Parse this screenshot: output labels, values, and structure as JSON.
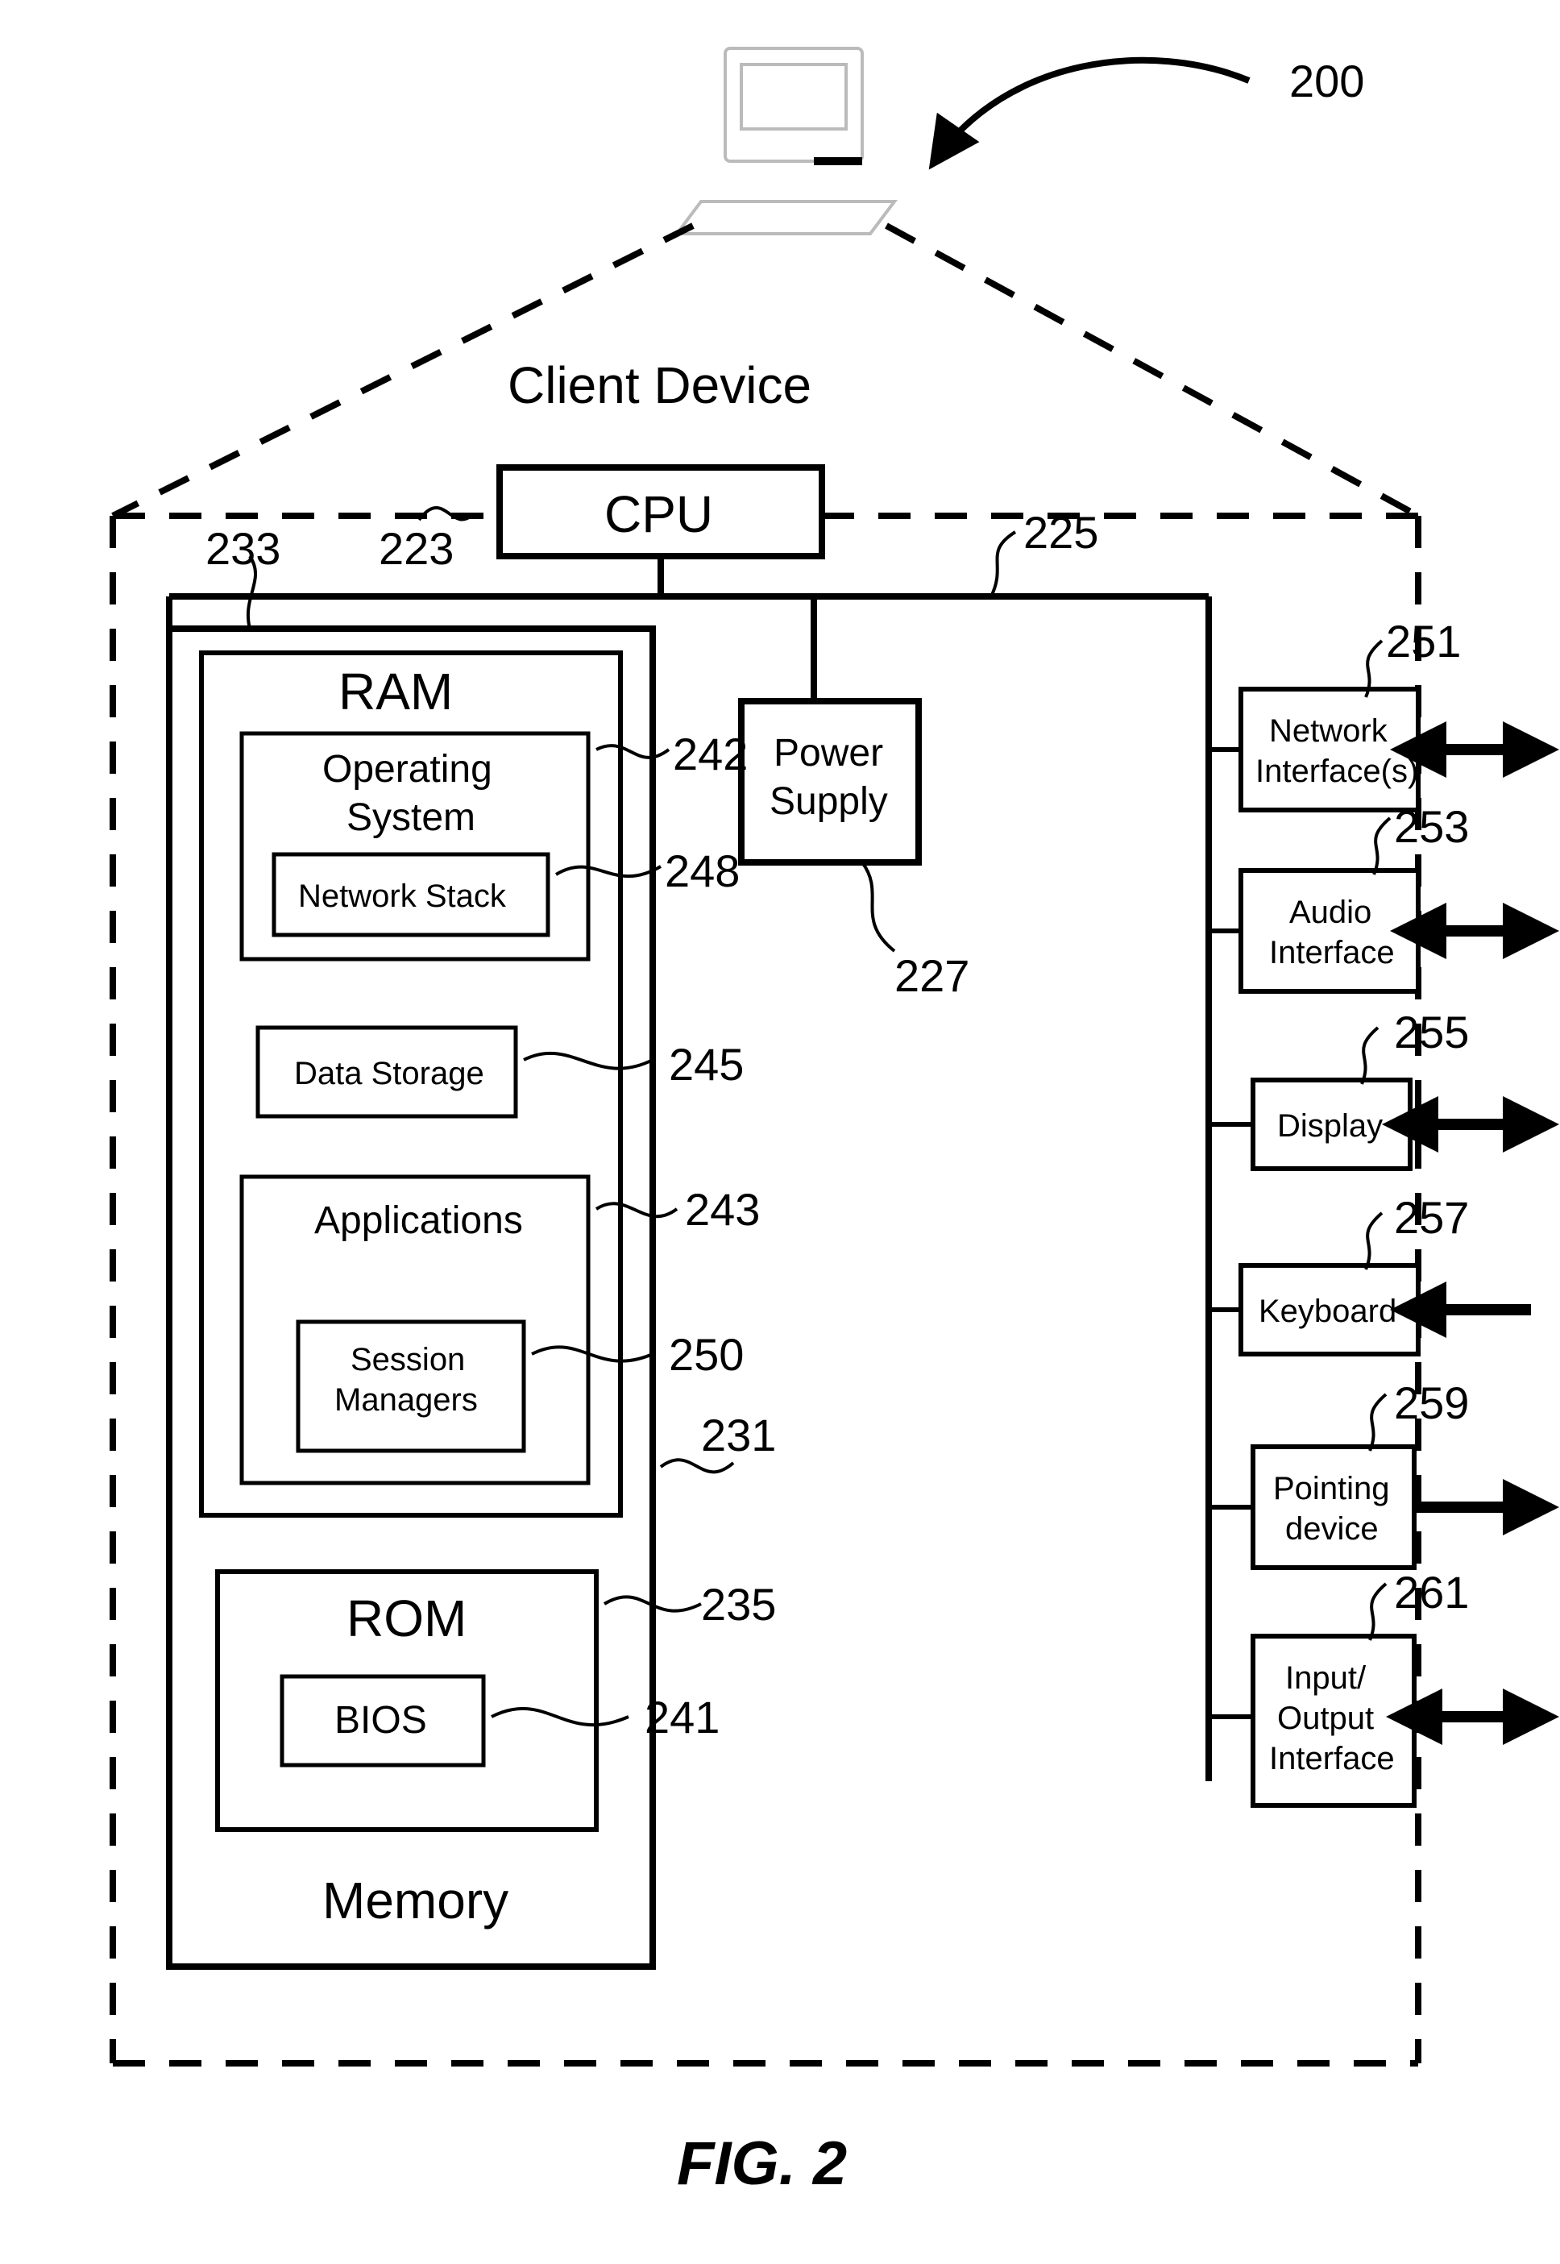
{
  "figureLabel": "FIG. 2",
  "clientDeviceLabel": "Client Device",
  "cpuLabel": "CPU",
  "powerSupplyLabel1": "Power",
  "powerSupplyLabel2": "Supply",
  "memoryLabel": "Memory",
  "ramLabel": "RAM",
  "osLabel1": "Operating",
  "osLabel2": "System",
  "netStackLabel": "Network Stack",
  "dataStorageLabel": "Data Storage",
  "applicationsLabel": "Applications",
  "sessionMgrLabel1": "Session",
  "sessionMgrLabel2": "Managers",
  "romLabel": "ROM",
  "biosLabel": "BIOS",
  "periph": {
    "netIf1": "Network",
    "netIf2": "Interface(s)",
    "audio1": "Audio",
    "audio2": "Interface",
    "display": "Display",
    "keyboard": "Keyboard",
    "pointing1": "Pointing",
    "pointing2": "device",
    "io1": "Input/",
    "io2": "Output",
    "io3": "Interface"
  },
  "refs": {
    "r200": "200",
    "r223": "223",
    "r225": "225",
    "r227": "227",
    "r231": "231",
    "r233": "233",
    "r235": "235",
    "r241": "241",
    "r242": "242",
    "r243": "243",
    "r245": "245",
    "r248": "248",
    "r250": "250",
    "r251": "251",
    "r253": "253",
    "r255": "255",
    "r257": "257",
    "r259": "259",
    "r261": "261"
  }
}
